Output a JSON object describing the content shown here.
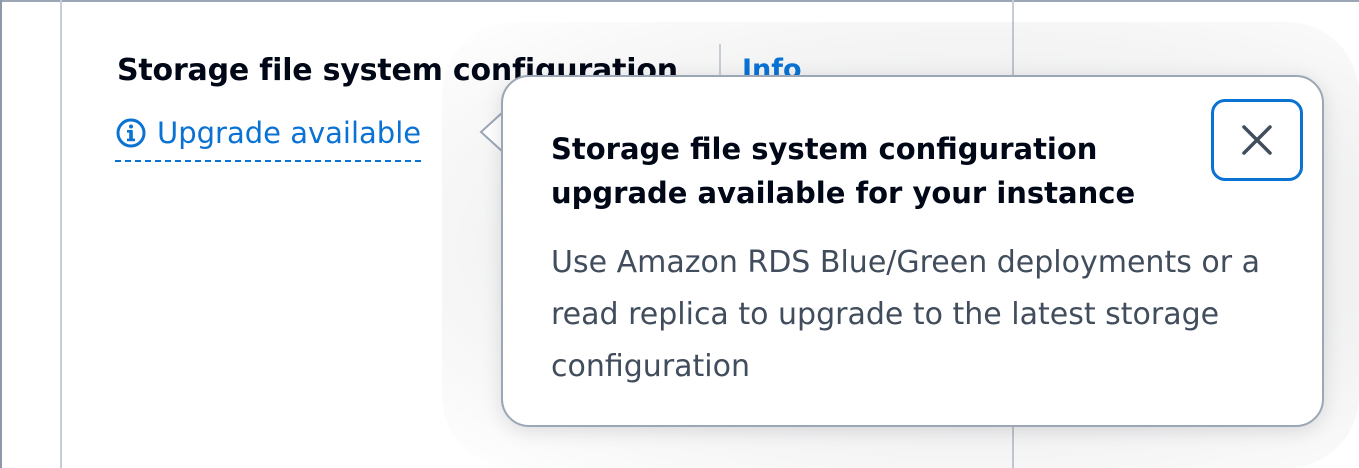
{
  "field": {
    "label": "Storage file system configuration",
    "info_link": "Info",
    "upgrade_trigger": "Upgrade available",
    "upgrade_icon": "info-circle-icon"
  },
  "popover": {
    "title": "Storage file system configuration upgrade available for your instance",
    "body": "Use Amazon RDS Blue/Green deployments or a read replica to upgrade to the latest storage configuration",
    "close_icon": "close-icon"
  },
  "colors": {
    "link": "#0972d3",
    "heading": "#000716",
    "body_text": "#414d5c",
    "border": "#9ba7b6"
  }
}
